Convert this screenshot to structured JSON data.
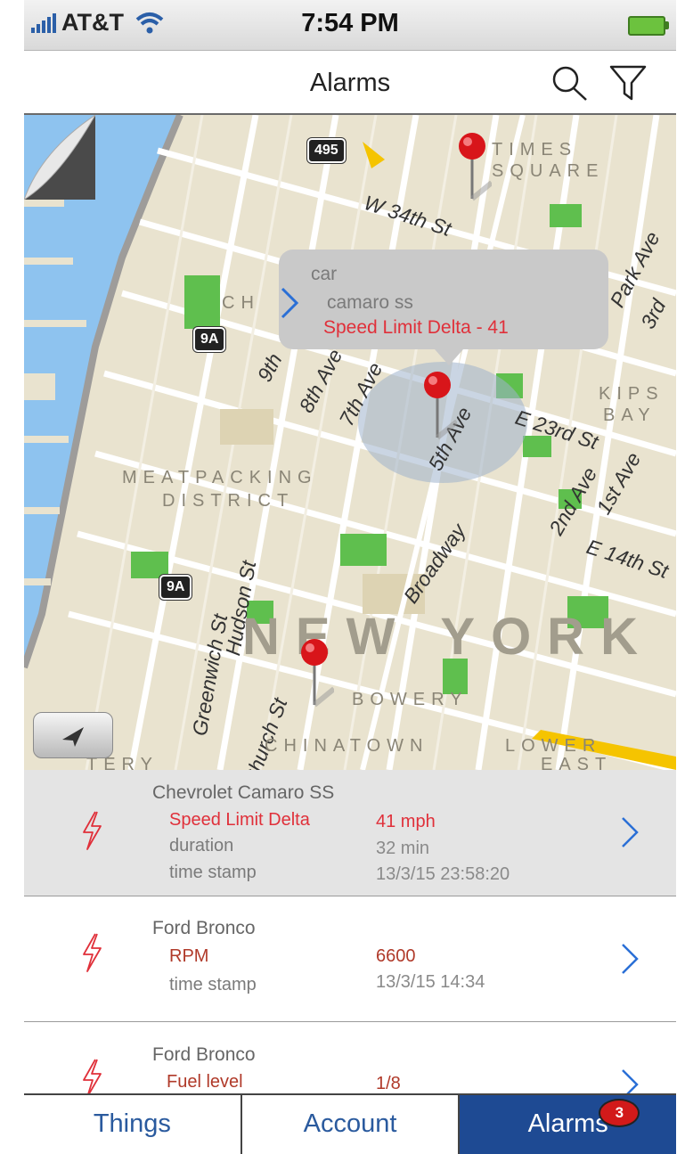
{
  "status_bar": {
    "carrier": "AT&T",
    "time": "7:54 PM"
  },
  "nav": {
    "title": "Alarms"
  },
  "map": {
    "streets": [
      "W 34th St",
      "9th",
      "8th Ave",
      "7th Ave",
      "5th Ave",
      "Broadway",
      "E 23rd St",
      "2nd Ave",
      "1st Ave",
      "E 14th St",
      "Hudson St",
      "Greenwich St",
      "Church St",
      "3rd",
      "Park Ave"
    ],
    "districts": [
      "TIMES",
      "SQUARE",
      "CH",
      "KIPS",
      "BAY",
      "MEATPACKING",
      "DISTRICT",
      "BOWERY",
      "CHINATOWN",
      "LOWER",
      "EAST",
      "TERY"
    ],
    "city": "NEW YORK",
    "shields": [
      "495",
      "9A",
      "9A"
    ],
    "callout": {
      "category": "car",
      "model": "camaro ss",
      "alarm": "Speed Limit Delta  - 41"
    }
  },
  "alarms": [
    {
      "device": "Chevrolet Camaro SS",
      "fields": [
        {
          "label": "Speed Limit Delta",
          "value": "41 mph"
        },
        {
          "label": "duration",
          "value": "32 min"
        },
        {
          "label": "time stamp",
          "value": "13/3/15  23:58:20"
        }
      ]
    },
    {
      "device": "Ford Bronco",
      "fields": [
        {
          "label": "RPM",
          "value": "6600"
        },
        {
          "label": "time stamp",
          "value": "13/3/15  14:34"
        }
      ]
    },
    {
      "device": "Ford Bronco",
      "fields": [
        {
          "label": "Fuel level",
          "value": "1/8"
        }
      ]
    }
  ],
  "tabs": [
    {
      "label": "Things"
    },
    {
      "label": "Account"
    },
    {
      "label": "Alarms",
      "badge": "3"
    }
  ],
  "colors": {
    "accent": "#1e4a93",
    "alarm_red": "#e0303a",
    "link_blue": "#2a5a9e",
    "water": "#8ec3ef",
    "park": "#5fbf4e"
  }
}
